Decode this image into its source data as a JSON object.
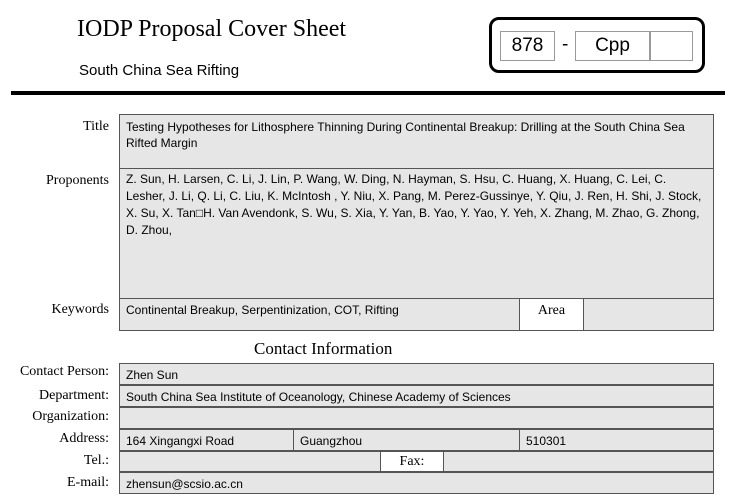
{
  "header": {
    "title": "IODP Proposal Cover Sheet",
    "subtitle": "South China Sea Rifting",
    "proposal_number": "878",
    "dash": "-",
    "proposal_type": "Cpp",
    "proposal_extra": ""
  },
  "proposal": {
    "title_label": "Title",
    "title_value": "Testing Hypotheses for Lithosphere Thinning During Continental Breakup: Drilling at the South China Sea Rifted Margin",
    "proponents_label": "Proponents",
    "proponents_value": "Z. Sun, H. Larsen, C. Li, J. Lin, P. Wang, W. Ding, N. Hayman, S. Hsu, C. Huang, X. Huang, C. Lei, C. Lesher, J. Li, Q. Li, C. Liu, K. McIntosh , Y. Niu, X. Pang, M. Perez-Gussinye, Y. Qiu, J. Ren, H. Shi, J. Stock, X. Su, X. Tan□H. Van Avendonk, S. Wu, S. Xia, Y. Yan, B. Yao, Y. Yao, Y. Yeh, X. Zhang, M. Zhao, G. Zhong, D. Zhou,",
    "keywords_label": "Keywords",
    "keywords_value": "Continental Breakup, Serpentinization, COT, Rifting",
    "area_label": "Area",
    "area_value": ""
  },
  "contact": {
    "section_title": "Contact Information",
    "person_label": "Contact Person:",
    "person_value": "Zhen  Sun",
    "department_label": "Department:",
    "department_value": "South China Sea Institute of Oceanology, Chinese Academy of Sciences",
    "organization_label": "Organization:",
    "organization_value": "",
    "address_label": "Address:",
    "address_street": "164 Xingangxi Road",
    "address_city": "Guangzhou",
    "address_postal": "510301",
    "tel_label": "Tel.:",
    "tel_value": "",
    "fax_label": "Fax:",
    "fax_value": "",
    "email_label": "E-mail:",
    "email_value": "zhensun@scsio.ac.cn"
  }
}
